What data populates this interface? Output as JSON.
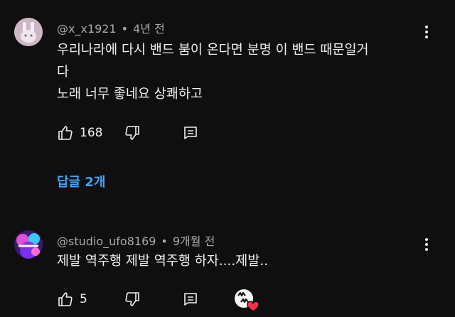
{
  "comments": [
    {
      "author": "@x_x1921",
      "time": "4년 전",
      "lines": [
        "우리나라에 다시 밴드 붐이 온다면 분명 이 밴드 때문일거",
        "다",
        "노래 너무 좋네요 상쾌하고"
      ],
      "likes": "168",
      "icons": [
        "like-icon",
        "dislike-icon",
        "reply-icon",
        "more-vert-icon"
      ]
    },
    {
      "author": "@studio_ufo8169",
      "time": "9개월 전",
      "lines": [
        "제발 역주행 제발 역주행 하자....제발.."
      ],
      "likes": "5",
      "icons": [
        "like-icon",
        "dislike-icon",
        "reply-icon",
        "creator-heart-icon",
        "more-vert-icon"
      ]
    }
  ],
  "replies_label": "답글 2개",
  "colors": {
    "background": "#0f0f0f",
    "text": "#f1f1f1",
    "meta": "#aaaaaa",
    "link": "#3ea6ff",
    "heart": "#ff2e4d"
  }
}
